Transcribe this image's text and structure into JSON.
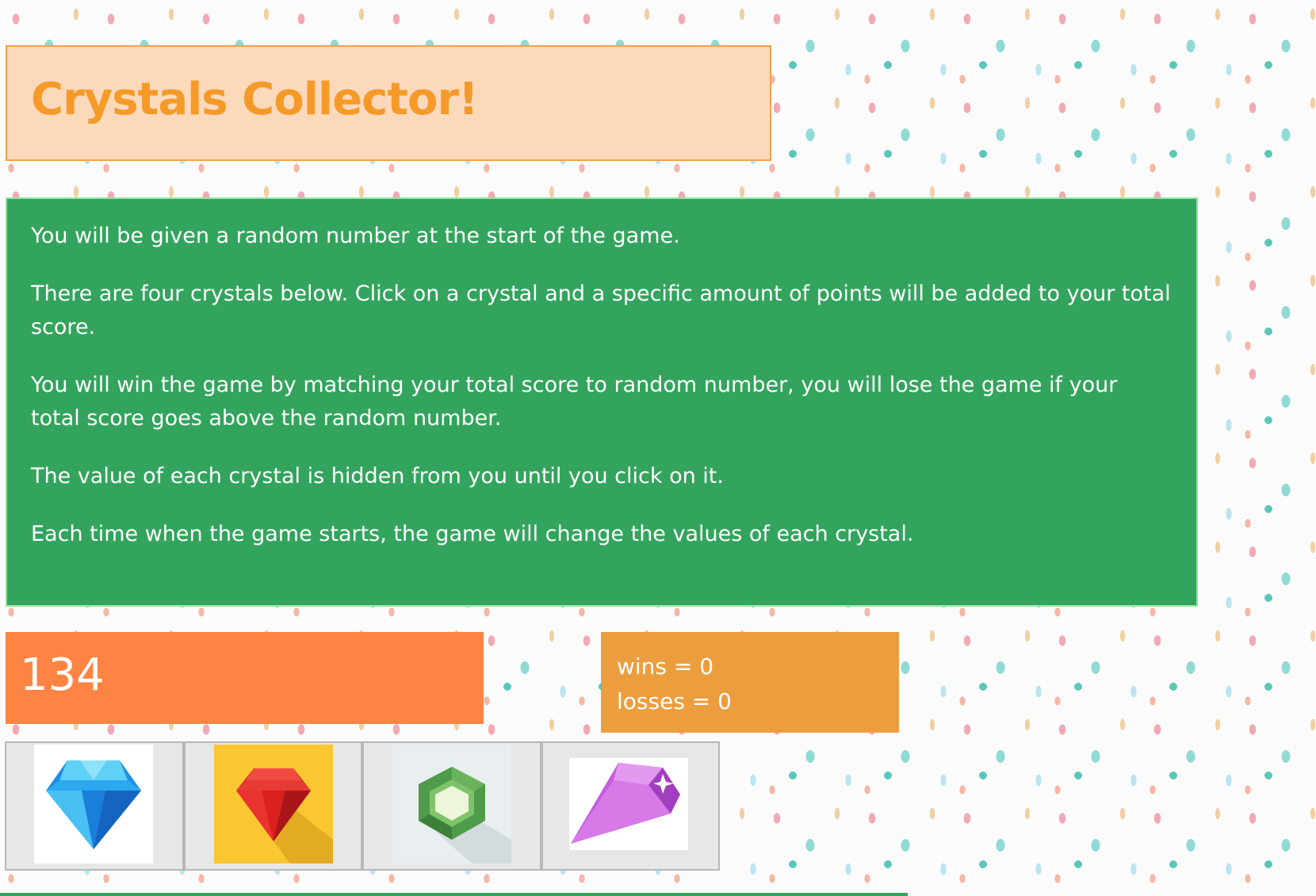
{
  "header": {
    "title": "Crystals Collector!"
  },
  "instructions": [
    "You will be given a random number at the start of the game.",
    "There are four crystals below. Click on a crystal and a specific amount of points will be added to your total score.",
    "You will win the game by matching your total score to random number, you will lose the game if your total score goes above the random number.",
    "The value of each crystal is hidden from you until you click on it.",
    "Each time when the game starts, the game will change the values of each crystal."
  ],
  "target": {
    "number": "134"
  },
  "score": {
    "wins": "wins = 0",
    "losses": "losses = 0"
  },
  "crystals": [
    {
      "icon": "blue-diamond-icon",
      "color": "#1e8fe6",
      "background": "#ffffff"
    },
    {
      "icon": "red-ruby-icon",
      "color": "#d9211e",
      "background": "#fbc632"
    },
    {
      "icon": "green-hexagon-gem-icon",
      "color": "#4e9b4a",
      "background": "#e9eef0"
    },
    {
      "icon": "purple-gem-icon",
      "color": "#c75de0",
      "background": "#ffffff"
    }
  ],
  "colors": {
    "title_text": "#f59a28",
    "title_background": "#fdd9bc",
    "instructions_background": "#33a45d",
    "target_background": "#fd8442",
    "score_background": "#ec9e3e"
  }
}
